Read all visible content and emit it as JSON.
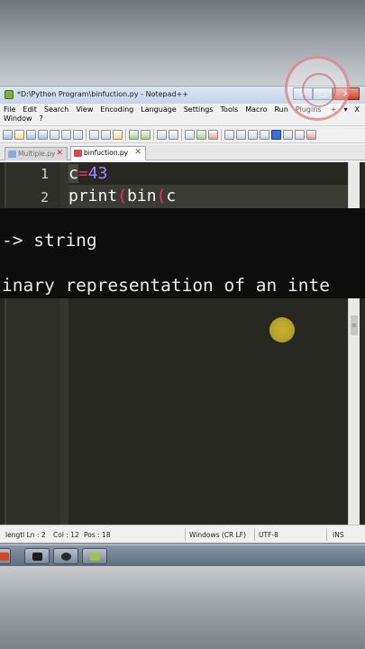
{
  "window": {
    "title": "*D:\\Python Program\\binfuction.py - Notepad++",
    "min_label": "–",
    "max_label": "□",
    "close_label": "✕"
  },
  "menu": {
    "row1": [
      "File",
      "Edit",
      "Search",
      "View",
      "Encoding",
      "Language",
      "Settings",
      "Tools",
      "Macro",
      "Run",
      "Plugins"
    ],
    "row2": [
      "Window",
      "?"
    ],
    "right_add": "+",
    "right_arrow": "▾",
    "right_close": "X"
  },
  "tabs": [
    {
      "label": "Multiple.py",
      "close": "✕",
      "active": false
    },
    {
      "label": "binfuction.py",
      "close": "✕",
      "active": true
    }
  ],
  "editor": {
    "lines": [
      {
        "num": "1",
        "var": "c",
        "op": "=",
        "num_val": "43"
      },
      {
        "num": "2",
        "fn": "print",
        "p1": "(",
        "fn2": "bin",
        "p2": "(",
        "arg": "c"
      }
    ],
    "scroll_marker": "≡"
  },
  "tooltip": {
    "line1": "-> string",
    "line2": "inary representation of an inte"
  },
  "status": {
    "length_line": "lengtl Ln : 2",
    "col": "Col : 12",
    "pos": "Pos : 18",
    "eol": "Windows (CR LF)",
    "encoding": "UTF-8",
    "mode": "INS"
  },
  "colors": {
    "editor_bg": "#272822",
    "keyword_pink": "#f92672",
    "number_purple": "#ae81ff",
    "cursor_highlight": "#d7c235"
  },
  "icons": {
    "app": "notepadpp-icon",
    "taskbar": [
      "powerpoint-icon",
      "cmd-icon",
      "obs-icon",
      "notepadpp-icon"
    ]
  }
}
